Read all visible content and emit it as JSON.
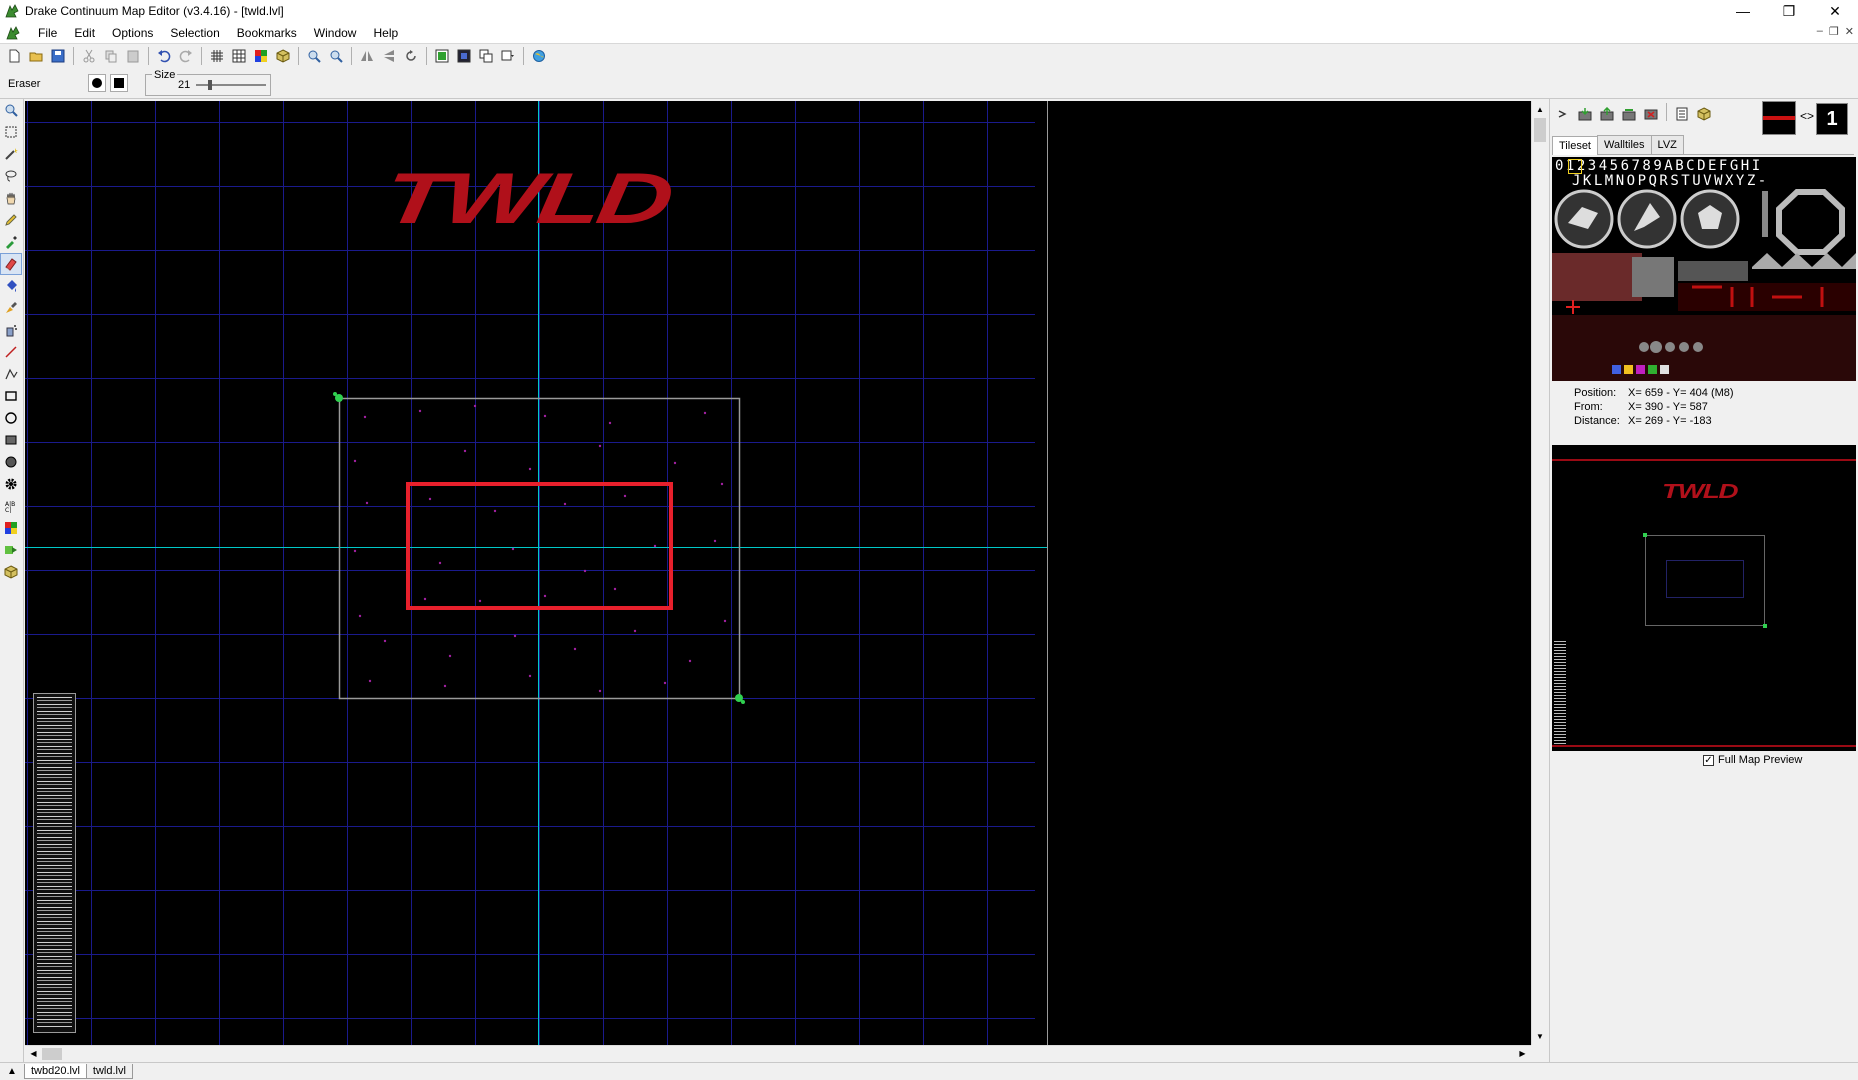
{
  "window": {
    "title": "Drake Continuum Map Editor (v3.4.16) - [twld.lvl]",
    "minimize": "—",
    "restore": "❐",
    "close": "✕"
  },
  "menu": [
    "File",
    "Edit",
    "Options",
    "Selection",
    "Bookmarks",
    "Window",
    "Help"
  ],
  "mdi_buttons": [
    "–",
    "❐",
    "✕"
  ],
  "options_bar": {
    "tool_name": "Eraser",
    "size_label": "Size",
    "size_value": "21"
  },
  "map": {
    "logo_text": "TWLD"
  },
  "right_panel": {
    "swap_symbol": "<>",
    "selected_tile": "1",
    "tabs": [
      "Tileset",
      "Walltiles",
      "LVZ"
    ],
    "tileset_row1": "0123456789ABCDEFGHI",
    "tileset_row2": "JKLMNOPQRSTUVWXYZ-",
    "status": {
      "position_label": "Position:",
      "position_value": "X= 659 - Y= 404 (M8)",
      "from_label": "From:",
      "from_value": "X= 390 - Y= 587",
      "distance_label": "Distance:",
      "distance_value": "X= 269 - Y= -183"
    },
    "minimap_logo": "TWLD",
    "full_map_preview_label": "Full Map Preview",
    "full_map_preview_checked": true
  },
  "bottom_tabs": [
    "twbd20.lvl",
    "twld.lvl"
  ],
  "colors": {
    "grid": "#1a1a8c",
    "crosshair": "#00d8d8",
    "logo": "#b0101a",
    "selection": "#e8202c",
    "border": "#9a9a9a"
  }
}
